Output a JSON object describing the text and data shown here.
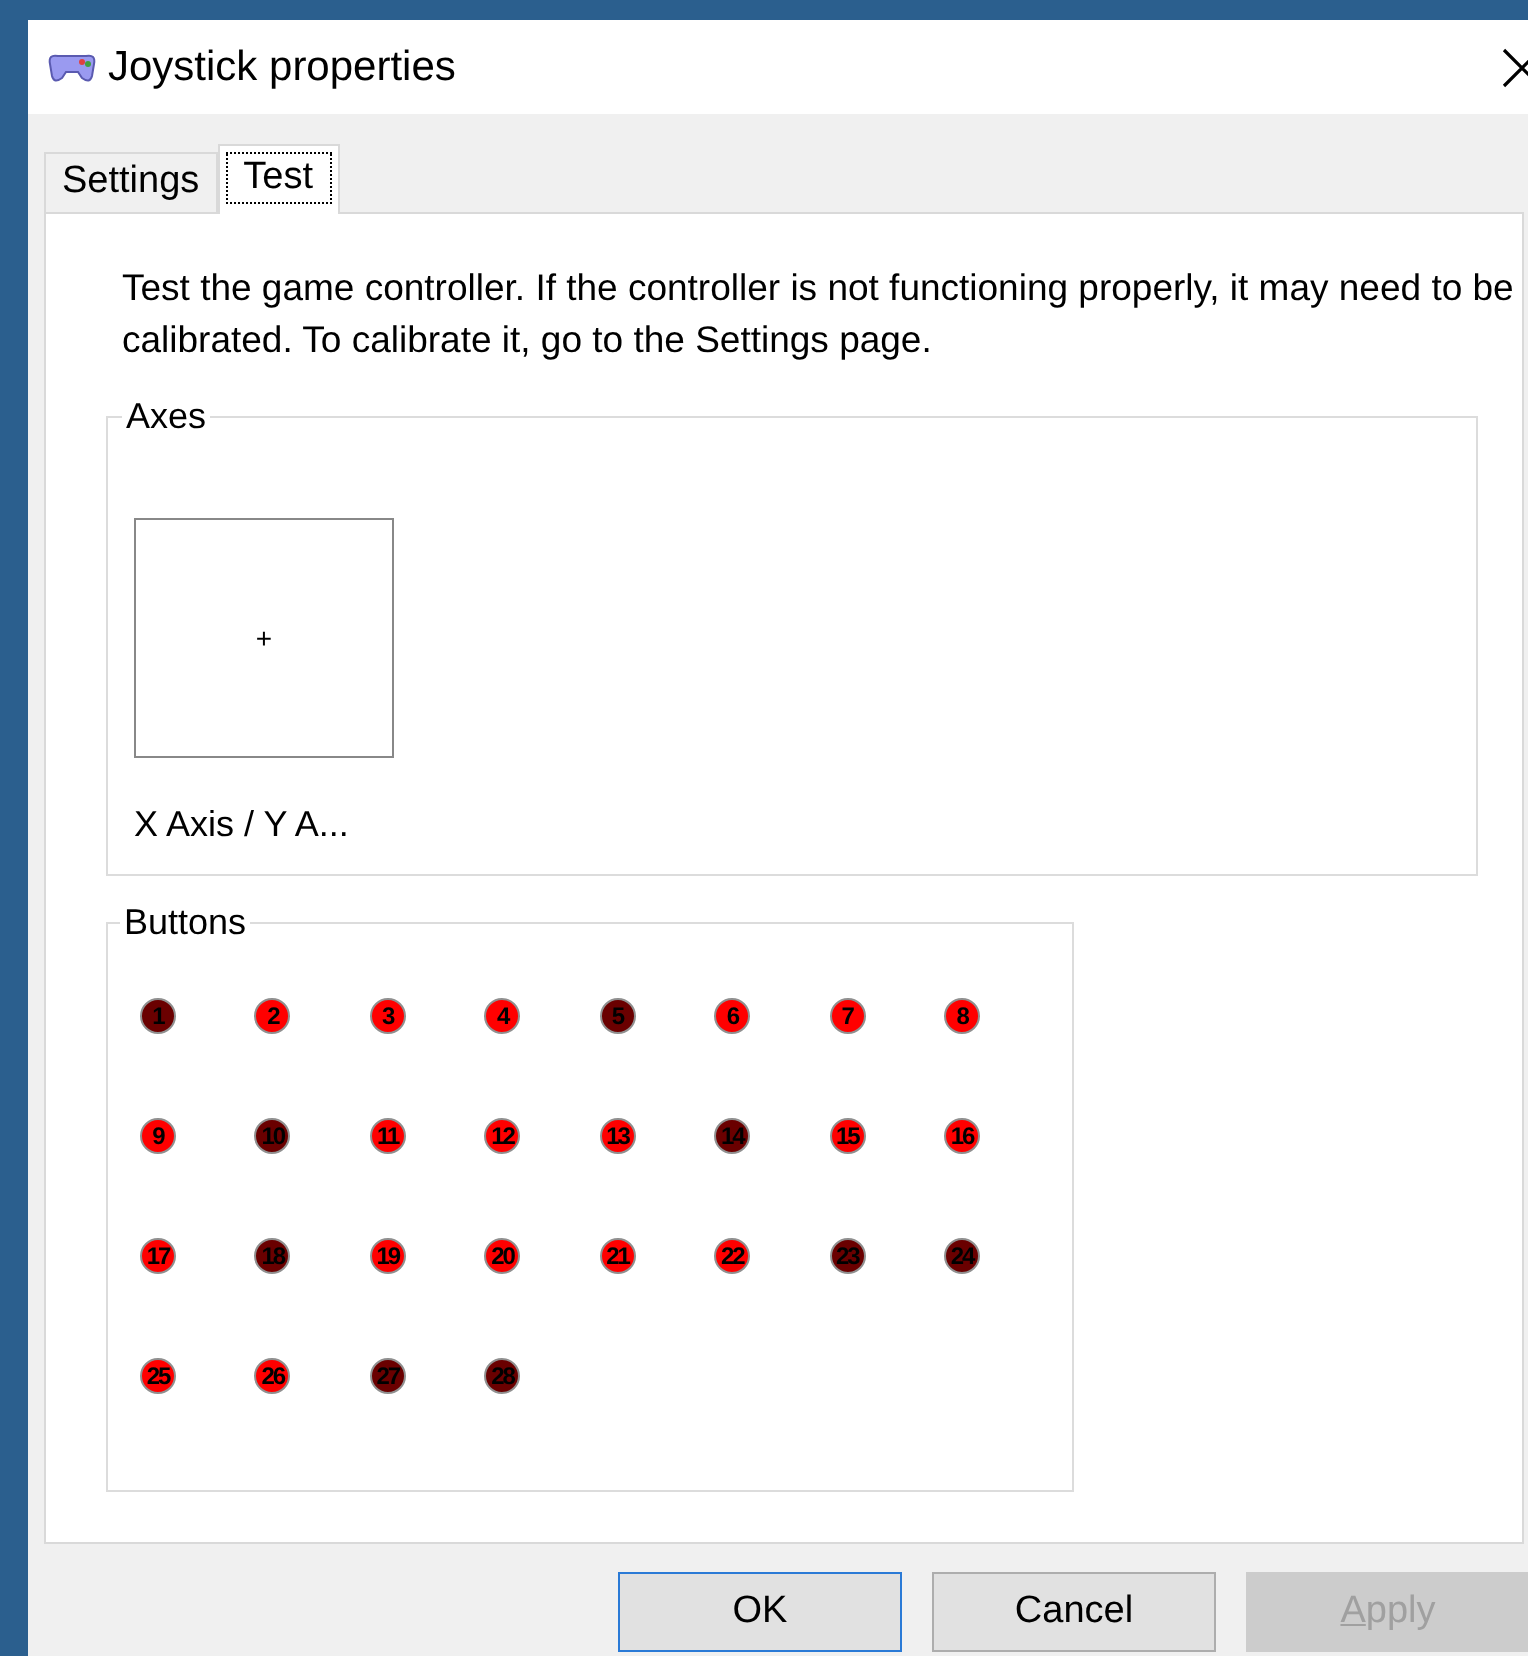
{
  "window": {
    "title": "Joystick properties"
  },
  "tabs": [
    {
      "label": "Settings",
      "selected": false
    },
    {
      "label": "Test",
      "selected": true
    }
  ],
  "description": "Test the game controller.  If the controller is not functioning properly, it may need to be calibrated.  To calibrate it, go to the Settings page.",
  "axes": {
    "title": "Axes",
    "label": "X Axis / Y A...",
    "crosshair": "+"
  },
  "buttons_group": {
    "title": "Buttons",
    "buttons": [
      {
        "label": "1",
        "lit": false
      },
      {
        "label": "2",
        "lit": true
      },
      {
        "label": "3",
        "lit": true
      },
      {
        "label": "4",
        "lit": true
      },
      {
        "label": "5",
        "lit": false
      },
      {
        "label": "6",
        "lit": true
      },
      {
        "label": "7",
        "lit": true
      },
      {
        "label": "8",
        "lit": true
      },
      {
        "label": "9",
        "lit": true
      },
      {
        "label": "10",
        "lit": false
      },
      {
        "label": "11",
        "lit": true
      },
      {
        "label": "12",
        "lit": true
      },
      {
        "label": "13",
        "lit": true
      },
      {
        "label": "14",
        "lit": false
      },
      {
        "label": "15",
        "lit": true
      },
      {
        "label": "16",
        "lit": true
      },
      {
        "label": "17",
        "lit": true
      },
      {
        "label": "18",
        "lit": false
      },
      {
        "label": "19",
        "lit": true
      },
      {
        "label": "20",
        "lit": true
      },
      {
        "label": "21",
        "lit": true
      },
      {
        "label": "22",
        "lit": true
      },
      {
        "label": "23",
        "lit": false
      },
      {
        "label": "24",
        "lit": false
      },
      {
        "label": "25",
        "lit": true
      },
      {
        "label": "26",
        "lit": true
      },
      {
        "label": "27",
        "lit": false
      },
      {
        "label": "28",
        "lit": false
      }
    ]
  },
  "dialog_buttons": [
    {
      "label": "OK",
      "default": true,
      "disabled": false
    },
    {
      "label": "Cancel",
      "default": false,
      "disabled": false
    },
    {
      "label": "Apply",
      "default": false,
      "disabled": true
    }
  ]
}
